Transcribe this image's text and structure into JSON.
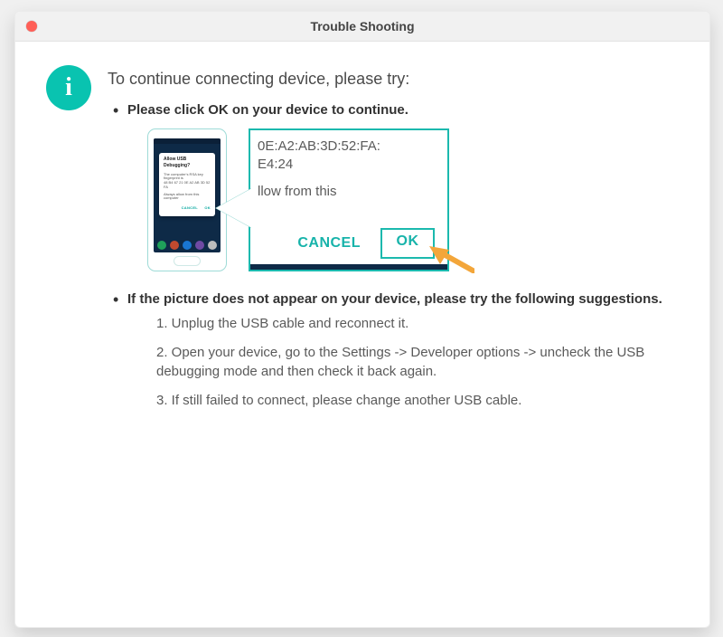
{
  "window": {
    "title": "Trouble Shooting"
  },
  "heading": "To continue connecting device, please try:",
  "bullet1": "Please click OK on your device to continue.",
  "bullet2": "If the picture does not appear on your device, please try the following suggestions.",
  "steps": {
    "s1": "1. Unplug the USB cable and reconnect it.",
    "s2": "2. Open your device, go to the Settings -> Developer options -> uncheck the USB debugging mode and then check it back again.",
    "s3": "3. If still failed to connect, please change another USB cable."
  },
  "phone_dialog": {
    "title": "Allow USB Debugging?",
    "sub1": "The computer's RSA key",
    "sub2": "fingerprint is",
    "sub3": "48 B4 67 21 0E A2 AB 3D 52 FA",
    "always": "Always allow from this computer",
    "cancel": "CANCEL",
    "ok": "OK"
  },
  "zoom": {
    "line1": "0E:A2:AB:3D:52:FA:",
    "line2": "E4:24",
    "line3": "llow from this",
    "cancel": "CANCEL",
    "ok": "OK"
  },
  "icons": {
    "info": "i"
  },
  "colors": {
    "accent": "#1bb9ae",
    "arrow": "#f3a63a",
    "close": "#ff5f57"
  }
}
